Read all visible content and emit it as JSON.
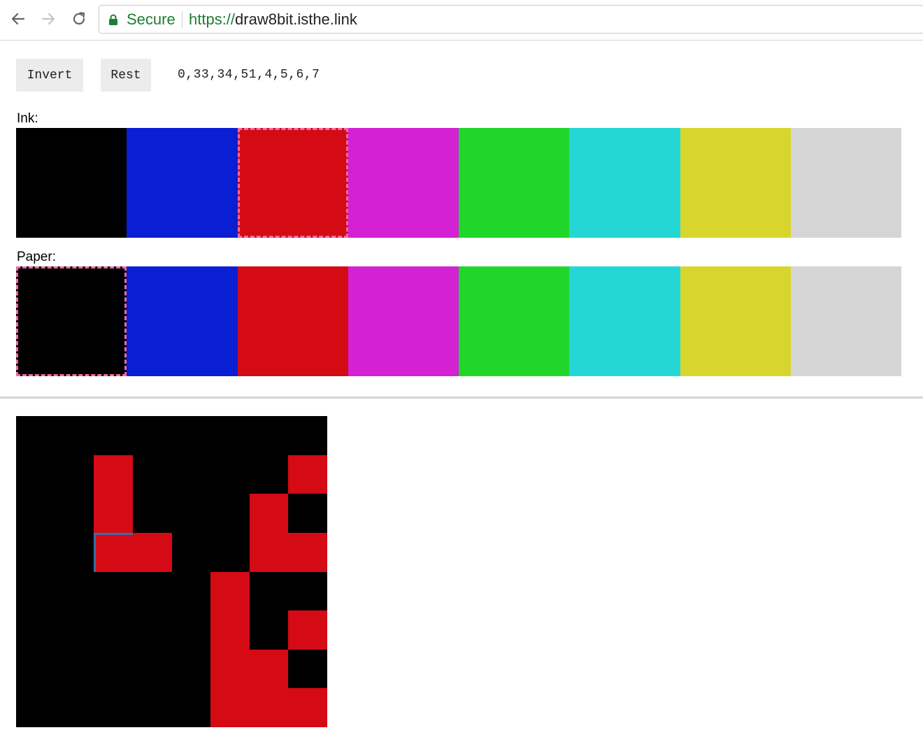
{
  "browser": {
    "secure_label": "Secure",
    "url_scheme": "https://",
    "url_host": "draw8bit.isthe.link",
    "colors": {
      "secure_green": "#1e7e34"
    }
  },
  "controls": {
    "invert_label": "Invert",
    "rest_label": "Rest",
    "palette_code": "0,33,34,51,4,5,6,7"
  },
  "ink": {
    "label": "Ink:",
    "selected_index": 2
  },
  "paper": {
    "label": "Paper:",
    "selected_index": 0
  },
  "palette": [
    {
      "name": "black",
      "hex": "#000000"
    },
    {
      "name": "blue",
      "hex": "#0a1ed4"
    },
    {
      "name": "red",
      "hex": "#d40a14"
    },
    {
      "name": "magenta",
      "hex": "#d321d3"
    },
    {
      "name": "green",
      "hex": "#21d62b"
    },
    {
      "name": "cyan",
      "hex": "#24d6d6"
    },
    {
      "name": "yellow",
      "hex": "#d8d62d"
    },
    {
      "name": "white",
      "hex": "#d5d5d5"
    }
  ],
  "canvas": {
    "size": 8,
    "ink_color": "#d40a14",
    "paper_color": "#000000",
    "hover_cell": [
      3,
      2
    ],
    "rows": [
      [
        0,
        0,
        0,
        0,
        0,
        0,
        0,
        0
      ],
      [
        0,
        0,
        1,
        0,
        0,
        0,
        0,
        1
      ],
      [
        0,
        0,
        1,
        0,
        0,
        0,
        1,
        0
      ],
      [
        0,
        0,
        1,
        1,
        0,
        0,
        1,
        1
      ],
      [
        0,
        0,
        0,
        0,
        0,
        1,
        0,
        0
      ],
      [
        0,
        0,
        0,
        0,
        0,
        1,
        0,
        1
      ],
      [
        0,
        0,
        0,
        0,
        0,
        1,
        1,
        0
      ],
      [
        0,
        0,
        0,
        0,
        0,
        1,
        1,
        1
      ]
    ]
  }
}
